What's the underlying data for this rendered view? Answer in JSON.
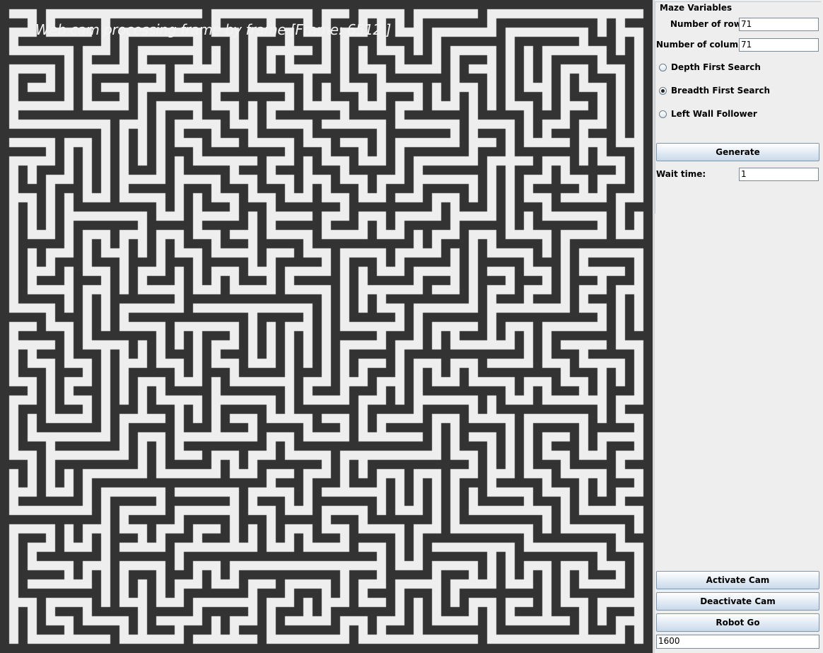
{
  "overlay": {
    "text": "Web cam processing frame by frame [Frame: 6512 ]"
  },
  "maze": {
    "rows": 71,
    "columns": 71,
    "wall_color": "#333333",
    "path_color": "#eeeeee"
  },
  "panel": {
    "title": "Maze Variables",
    "rows_label": "Number of rows:",
    "rows_value": "71",
    "cols_label": "Number of columns:",
    "cols_value": "71",
    "algorithms": [
      {
        "label": "Depth First Search",
        "selected": false
      },
      {
        "label": "Breadth First Search",
        "selected": true
      },
      {
        "label": "Left Wall Follower",
        "selected": false
      }
    ],
    "generate_label": "Generate",
    "wait_label": "Wait time:",
    "wait_value": "1",
    "activate_label": "Activate Cam",
    "deactivate_label": "Deactivate Cam",
    "robot_label": "Robot Go",
    "bottom_value": "1600"
  }
}
